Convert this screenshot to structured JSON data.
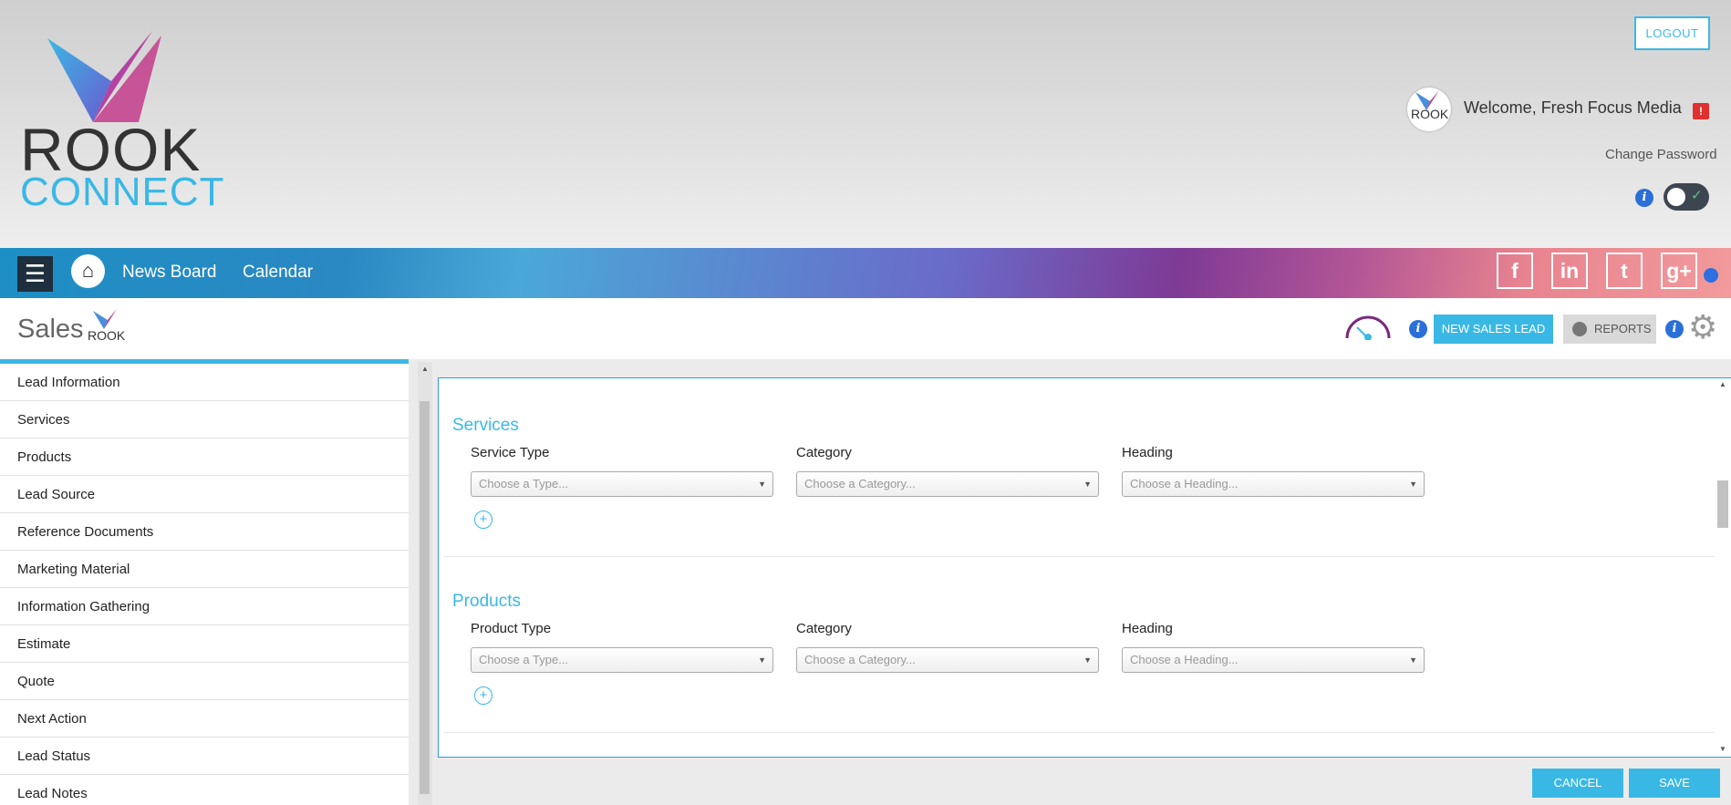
{
  "header": {
    "logo_top": "ROOK",
    "logo_bottom": "CONNECT",
    "logout_label": "LOGOUT",
    "avatar_text": "ROOK",
    "welcome_text": "Welcome, Fresh Focus Media",
    "alert_glyph": "!",
    "change_password": "Change Password",
    "info_glyph": "i",
    "toggle_check": "✓"
  },
  "nav": {
    "menu_glyph": "☰",
    "home_glyph": "⌂",
    "links": [
      "News Board",
      "Calendar"
    ],
    "social": [
      {
        "icon": "facebook-icon",
        "glyph": "f"
      },
      {
        "icon": "linkedin-icon",
        "glyph": "in"
      },
      {
        "icon": "twitter-icon",
        "glyph": "t"
      },
      {
        "icon": "google-plus-icon",
        "glyph": "g+"
      }
    ]
  },
  "salesbar": {
    "title": "Sales",
    "logo_text": "ROOK",
    "new_lead_label": "NEW SALES LEAD",
    "reports_label": "REPORTS",
    "gear_glyph": "⚙"
  },
  "sidebar": {
    "items": [
      "Lead Information",
      "Services",
      "Products",
      "Lead Source",
      "Reference Documents",
      "Marketing Material",
      "Information Gathering",
      "Estimate",
      "Quote",
      "Next Action",
      "Lead Status",
      "Lead Notes"
    ]
  },
  "main": {
    "services": {
      "title": "Services",
      "labels": [
        "Service Type",
        "Category",
        "Heading"
      ],
      "placeholders": [
        "Choose a Type...",
        "Choose a Category...",
        "Choose a Heading..."
      ]
    },
    "products": {
      "title": "Products",
      "labels": [
        "Product Type",
        "Category",
        "Heading"
      ],
      "placeholders": [
        "Choose a Type...",
        "Choose a Category...",
        "Choose a Heading..."
      ]
    },
    "add_glyph": "+",
    "caret_glyph": "▼",
    "scroll_up_glyph": "▲",
    "scroll_down_glyph": "▼"
  },
  "footer": {
    "cancel_label": "CANCEL",
    "save_label": "SAVE"
  },
  "colors": {
    "accent": "#3ab8e5",
    "info": "#2b6fd8",
    "alert": "#e03030"
  }
}
